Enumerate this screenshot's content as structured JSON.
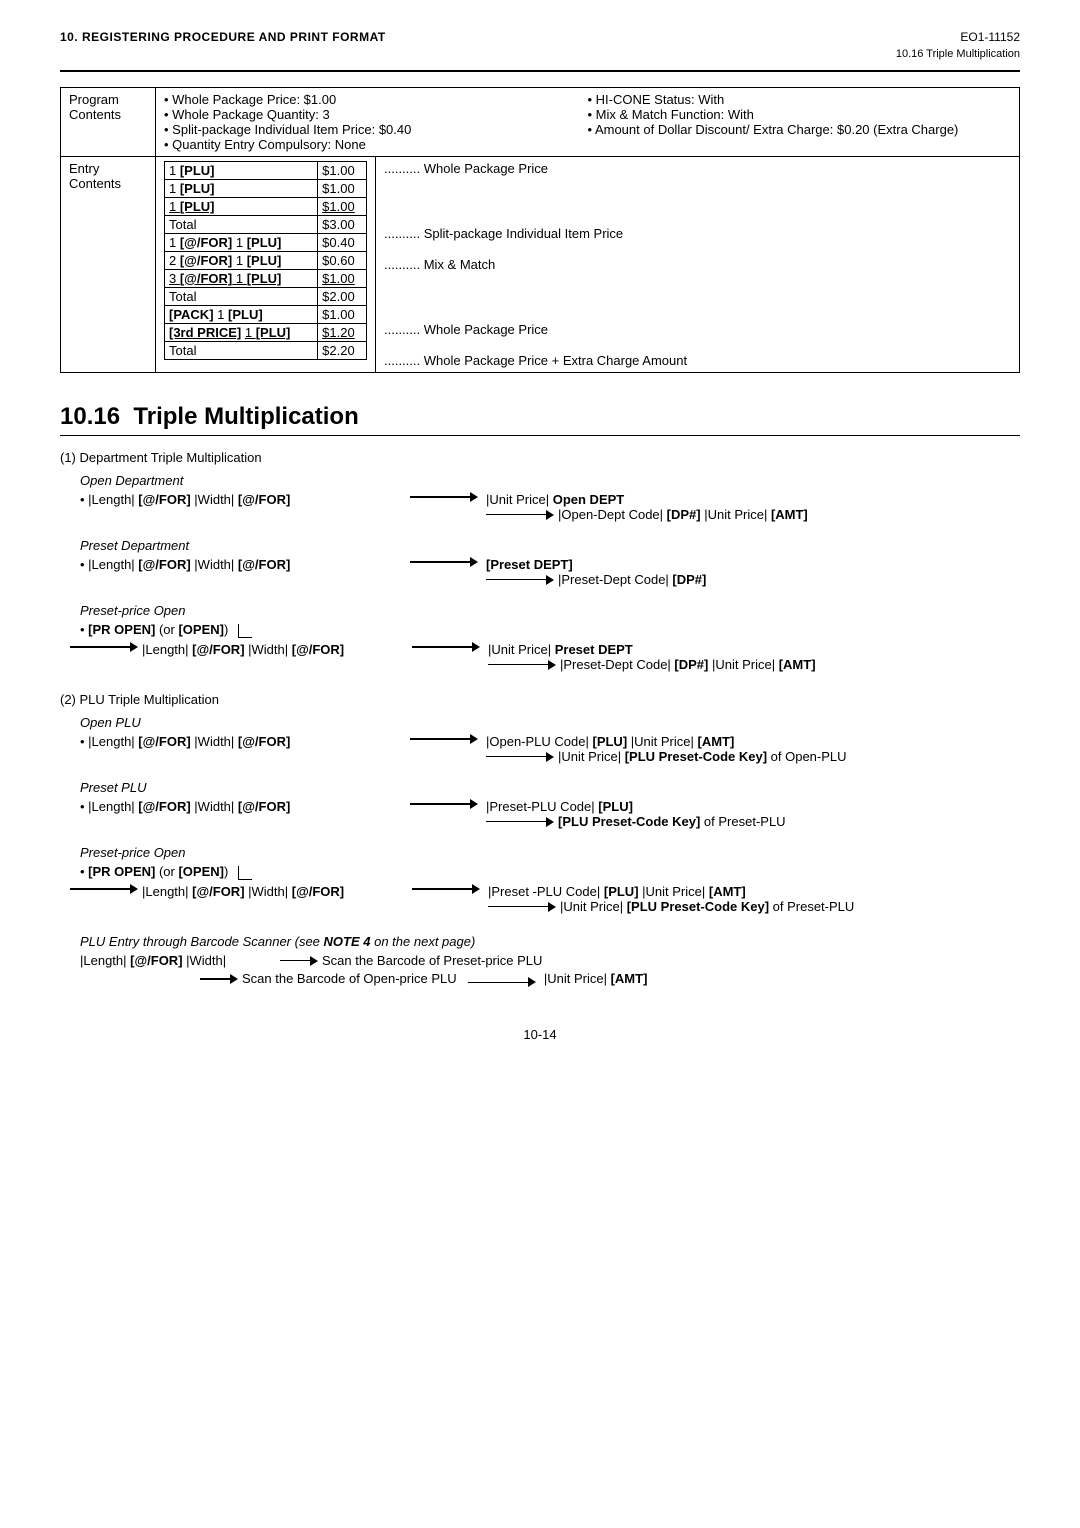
{
  "header": {
    "left": "10. REGISTERING PROCEDURE AND PRINT FORMAT",
    "right": "EO1-11152",
    "sub": "10.16 Triple Multiplication"
  },
  "program_table": {
    "rows": [
      {
        "label": "Program\nContents",
        "left_items": [
          "• Whole Package Price: $1.00",
          "• Whole Package Quantity: 3",
          "• Split-package Individual Item Price: $0.40",
          "• Quantity Entry Compulsory: None"
        ],
        "right_items": [
          "• HI-CONE Status: With",
          "• Mix & Match Function: With",
          "• Amount of Dollar Discount/ Extra Charge: $0.20 (Extra Charge)"
        ]
      }
    ],
    "entry_label": "Entry\nContents",
    "entries": [
      {
        "col1": "1 [PLU]",
        "col1_bold": true,
        "col2": "$1.00",
        "col3": ".......... Whole Package Price"
      },
      {
        "col1": "1 [PLU]",
        "col1_bold": true,
        "col2": "$1.00",
        "col3": ""
      },
      {
        "col1": "1 [PLU]",
        "col1_bold": true,
        "col1_ul": true,
        "col2": "$1.00",
        "col2_ul": true,
        "col3": ""
      },
      {
        "col1": "Total",
        "col2": "$3.00",
        "col3": ""
      },
      {
        "col1": "1 [@/FOR] 1 [PLU]",
        "col1_bold": true,
        "col2": "$0.40",
        "col3": ".......... Split-package Individual Item Price"
      },
      {
        "col1": "2 [@/FOR] 1 [PLU]",
        "col1_bold": true,
        "col2": "$0.60",
        "col3": ""
      },
      {
        "col1": "3 [@/FOR] 1 [PLU]",
        "col1_bold": true,
        "col1_ul": true,
        "col2": "$1.00",
        "col2_ul": true,
        "col3": ".......... Mix & Match"
      },
      {
        "col1": "Total",
        "col2": "$2.00",
        "col3": ""
      },
      {
        "col1": "[PACK] 1 [PLU]",
        "col1_bold": true,
        "col2": "$1.00",
        "col3": ".......... Whole Package Price"
      },
      {
        "col1": "[3rd PRICE] 1 [PLU]",
        "col1_bold": true,
        "col1_ul": true,
        "col2": "$1.20",
        "col2_ul": true,
        "col3": ".......... Whole Package Price + Extra Charge Amount"
      },
      {
        "col1": "Total",
        "col2": "$2.20",
        "col3": ""
      }
    ]
  },
  "section": {
    "number": "10.16",
    "title": "Triple Multiplication"
  },
  "dept_triple": {
    "heading": "(1) Department Triple Multiplication",
    "open_dept": {
      "title": "Open Department",
      "bullet": "• |Length| [@/FOR] |Width| [@/FOR]",
      "arrow1_text1": "|Unit Price| Open DEPT",
      "arrow1_text2": "|Open-Dept Code| [DP#] |Unit Price| [AMT]"
    },
    "preset_dept": {
      "title": "Preset Department",
      "bullet": "• |Length| [@/FOR] |Width| [@/FOR]",
      "arrow1_text1": "[Preset DEPT]",
      "arrow1_text2": "|Preset-Dept Code| [DP#]"
    },
    "preset_price_open": {
      "title": "Preset-price Open",
      "bullet": "• [PR OPEN] (or [OPEN])",
      "sub_bullet": "|Length| [@/FOR] |Width| [@/FOR]",
      "arrow1_text1": "|Unit Price| [Preset DEPT]",
      "arrow1_text2": "|Preset-Dept Code| [DP#] |Unit Price| [AMT]"
    }
  },
  "plu_triple": {
    "heading": "(2) PLU Triple Multiplication",
    "open_plu": {
      "title": "Open PLU",
      "bullet": "• |Length| [@/FOR] |Width| [@/FOR]",
      "arrow1_text1": "|Open-PLU Code| [PLU] |Unit Price| [AMT]",
      "arrow1_text2": "|Unit Price| [PLU Preset-Code Key] of Open-PLU"
    },
    "preset_plu": {
      "title": "Preset PLU",
      "bullet": "• |Length| [@/FOR] |Width| [@/FOR]",
      "arrow1_text1": "|Preset-PLU Code| [PLU]",
      "arrow1_text2": "[PLU Preset-Code Key] of Preset-PLU"
    },
    "preset_price_open": {
      "title": "Preset-price Open",
      "bullet": "• [PR OPEN] (or [OPEN])",
      "sub_bullet": "|Length| [@/FOR] |Width| [@/FOR]",
      "arrow1_text1": "|Preset -PLU Code| [PLU] |Unit Price| [AMT]",
      "arrow1_text2": "|Unit Price| [PLU Preset-Code Key] of Preset-PLU"
    }
  },
  "barcode_section": {
    "label": "PLU Entry through Barcode Scanner (see NOTE 4 on the next page)",
    "row1_left": "|Length| [@/FOR] |Width|",
    "row1_right": "Scan the Barcode of Preset-price PLU",
    "row2_right": "Scan the Barcode of Open-price PLU",
    "row2_arrow_right": "|Unit Price| [AMT]"
  },
  "footer": {
    "page": "10-14"
  }
}
